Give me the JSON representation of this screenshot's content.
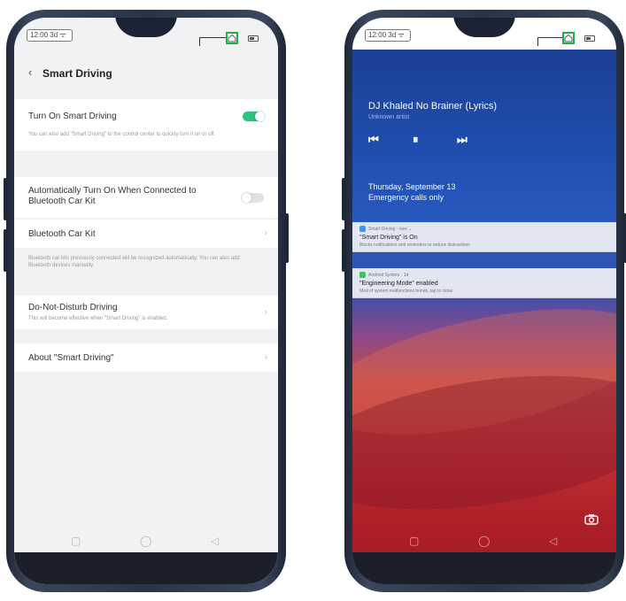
{
  "status_bar": {
    "time": "12:00 3d ᯤ"
  },
  "left_screen": {
    "title": "Smart Driving",
    "turn_on": {
      "label": "Turn On Smart Driving",
      "note": "You can also add \"Smart Driving\" to the control center to quickly turn it on or off.",
      "enabled": true
    },
    "auto_turn_on": {
      "label": "Automatically Turn On When Connected to Bluetooth Car Kit",
      "enabled": false
    },
    "bluetooth_car_kit": {
      "label": "Bluetooth Car Kit",
      "note": "Bluetooth car kits previously connected will be recognized automatically. You can also add Bluetooth devices manually."
    },
    "dnd": {
      "label": "Do-Not-Disturb Driving",
      "note": "This will become effective when \"Smart Driving\" is enabled."
    },
    "about": {
      "label": "About \"Smart Driving\""
    },
    "nav": {
      "recents": "▢",
      "home": "◯",
      "back": "◁"
    }
  },
  "right_screen": {
    "media": {
      "title": "DJ Khaled No Brainer (Lyrics)",
      "artist": "Unknown artist",
      "prev": "⏮",
      "pause": "⏸",
      "next": "⏭"
    },
    "date": "Thursday, September 13",
    "emergency": "Emergency calls only",
    "notifications": [
      {
        "app": "Smart Driving · now ⌄",
        "title": "\"Smart Driving\" is On",
        "body": "Blocks notifications and reminders to reduce distractions",
        "icon_color": "#4a8ef0"
      },
      {
        "app": "Android System · 1d",
        "title": "\"Engineering Mode\" enabled",
        "body": "Mod of system malfunctions bonds, tap to close",
        "icon_color": "#3cc45a"
      }
    ],
    "camera_icon": "camera-icon"
  },
  "colors": {
    "accent_green": "#1fb04a",
    "toggle_on": "#2ec27e"
  }
}
